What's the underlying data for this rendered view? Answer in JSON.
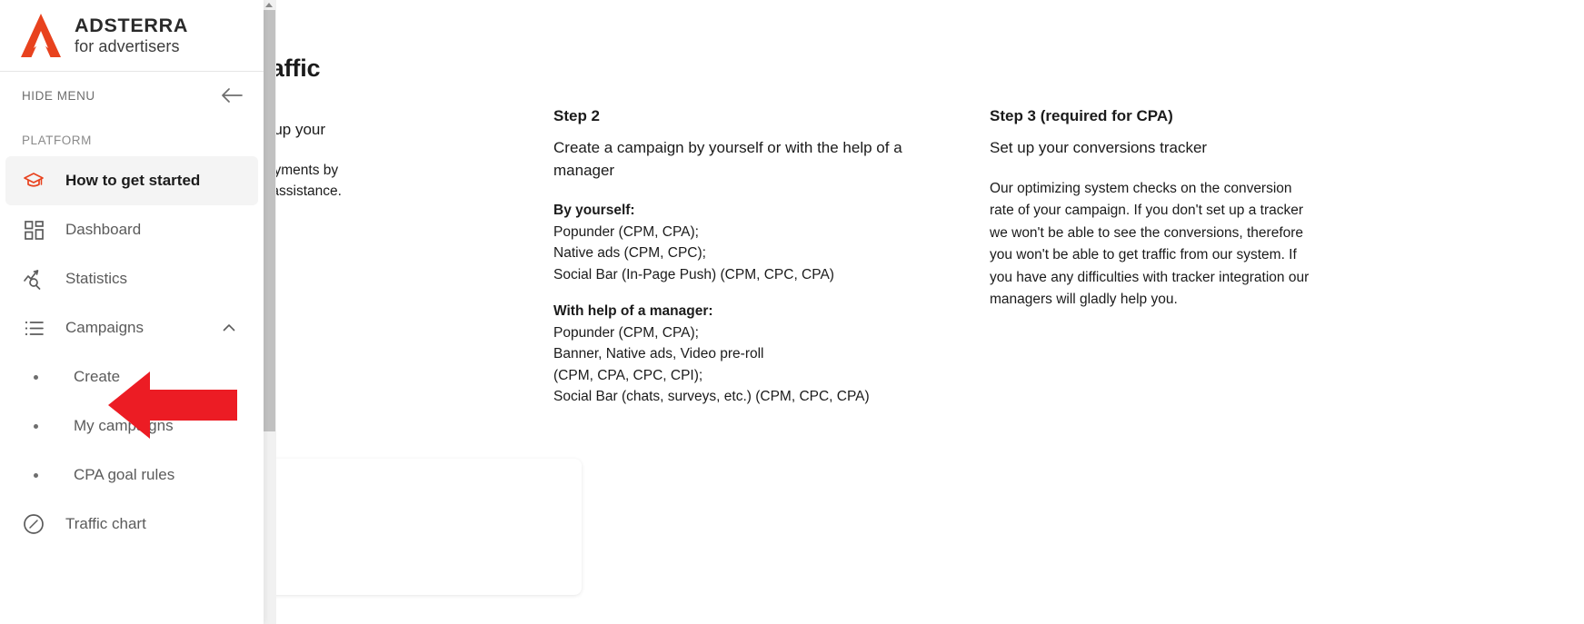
{
  "sidebar": {
    "brand": {
      "name": "ADSTERRA",
      "subtitle": "for advertisers",
      "logo_color": "#E8421E"
    },
    "hide_menu": {
      "label": "HIDE MENU",
      "icon": "arrow-left-icon"
    },
    "section_label": "PLATFORM",
    "items": [
      {
        "label": "How to get started",
        "icon": "graduation-cap-icon",
        "active": true
      },
      {
        "label": "Dashboard",
        "icon": "grid-squares-icon",
        "active": false
      },
      {
        "label": "Statistics",
        "icon": "chart-search-icon",
        "active": false
      },
      {
        "label": "Campaigns",
        "icon": "list-icon",
        "active": false,
        "expanded": true,
        "chevron": "chevron-up-icon"
      },
      {
        "label": "Traffic chart",
        "icon": "compass-icon",
        "active": false
      }
    ],
    "campaign_subitems": [
      {
        "label": "Create"
      },
      {
        "label": "My campaigns"
      },
      {
        "label": "CPA goal rules"
      }
    ]
  },
  "annotation": {
    "arrow_color": "#EC1C24",
    "points_at": "Create"
  },
  "scrollbar": {
    "position": "main-content-left",
    "thumb_color": "#c1c1c1",
    "track_color": "#f1f1f1"
  },
  "main": {
    "page_title": "start getting traffic",
    "steps": [
      {
        "label": "",
        "heading": "ayment method and top up your",
        "sub": "",
        "lines": [
          "nods allow you to make payments by",
          "thers require a manager's assistance."
        ]
      },
      {
        "label": "Step 2",
        "heading": "Create a campaign by yourself or with the help of a manager",
        "group1_title": "By yourself:",
        "group1_lines": [
          "Popunder (CPM, CPA);",
          "Native ads (CPM, CPC);",
          "Social Bar (In-Page Push) (CPM, CPC, CPA)"
        ],
        "group2_title": "With help of a manager:",
        "group2_lines": [
          "Popunder (CPM, CPA);",
          "Banner, Native ads, Video pre-roll",
          "(CPM, CPA, CPC, CPI);",
          "Social Bar (chats, surveys, etc.) (CPM, CPC, CPA)"
        ]
      },
      {
        "label": "Step 3 (required for CPA)",
        "heading": "Set up your conversions tracker",
        "paragraph": "Our optimizing system checks on the conversion rate of your campaign. If you don't set up a tracker we won't be able to see the conversions, therefore you won't be able to get traffic from our system. If you have any difficulties with tracker integration our managers will gladly help you."
      }
    ]
  }
}
